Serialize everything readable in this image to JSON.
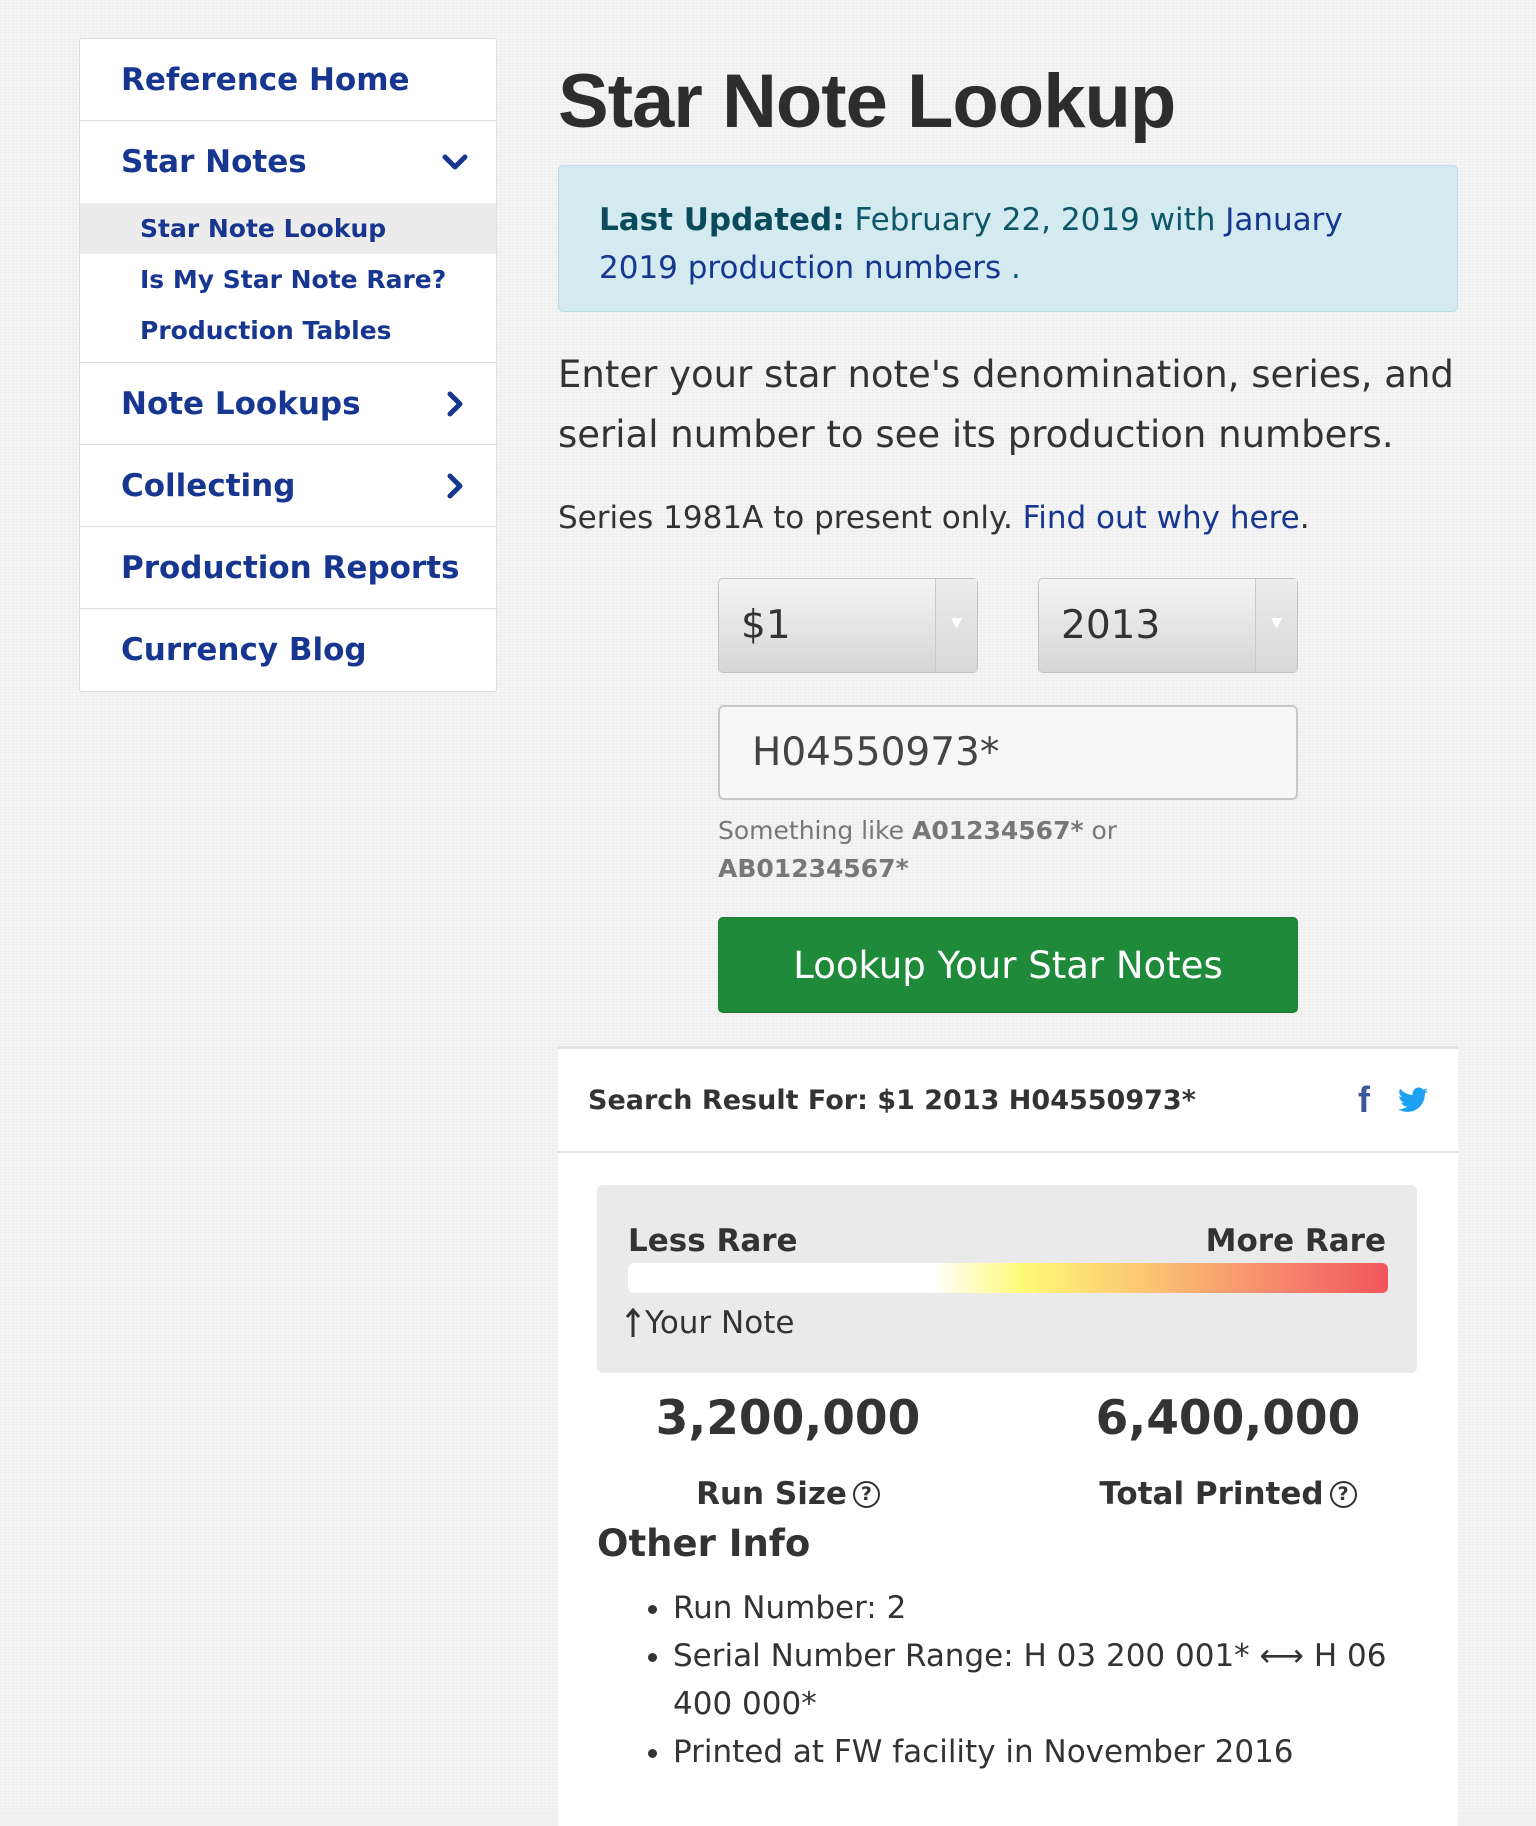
{
  "sidebar": {
    "reference_home": "Reference Home",
    "star_notes": "Star Notes",
    "sub_items": [
      "Star Note Lookup",
      "Is My Star Note Rare?",
      "Production Tables"
    ],
    "note_lookups": "Note Lookups",
    "collecting": "Collecting",
    "production_reports": "Production Reports",
    "currency_blog": "Currency Blog"
  },
  "main": {
    "title": "Star Note Lookup",
    "alert": {
      "label": "Last Updated:",
      "text": " February 22, 2019 with ",
      "link": "January 2019 production numbers",
      "suffix": " ."
    },
    "intro": "Enter your star note's denomination, series, and serial number to see its production numbers.",
    "series_note": "Series 1981A to present only. ",
    "series_link": "Find out why here",
    "series_period": ".",
    "denomination": "$1",
    "series": "2013",
    "serial_value": "H04550973*",
    "hint_prefix": "Something like ",
    "hint_ex1": "A01234567*",
    "hint_or": " or ",
    "hint_ex2": "AB01234567*",
    "lookup_button": "Lookup Your Star Notes"
  },
  "result": {
    "title": "Search Result For: $1 2013 H04550973*",
    "less_rare": "Less Rare",
    "more_rare": "More Rare",
    "your_note": "Your Note",
    "run_size_value": "3,200,000",
    "run_size_label": "Run Size",
    "total_printed_value": "6,400,000",
    "total_printed_label": "Total Printed",
    "other_info_title": "Other Info",
    "other_info": [
      "Run Number: 2",
      "Serial Number Range: H 03 200 001* ⟷ H 06 400 000*",
      "Printed at FW facility in November 2016"
    ]
  },
  "icons": {
    "facebook": "facebook-icon",
    "twitter": "twitter-icon"
  },
  "colors": {
    "link": "#16368f",
    "button": "#1f8a3a",
    "alert_bg": "#d2eaf0",
    "twitter": "#1da1f2",
    "facebook": "#3b5998"
  }
}
